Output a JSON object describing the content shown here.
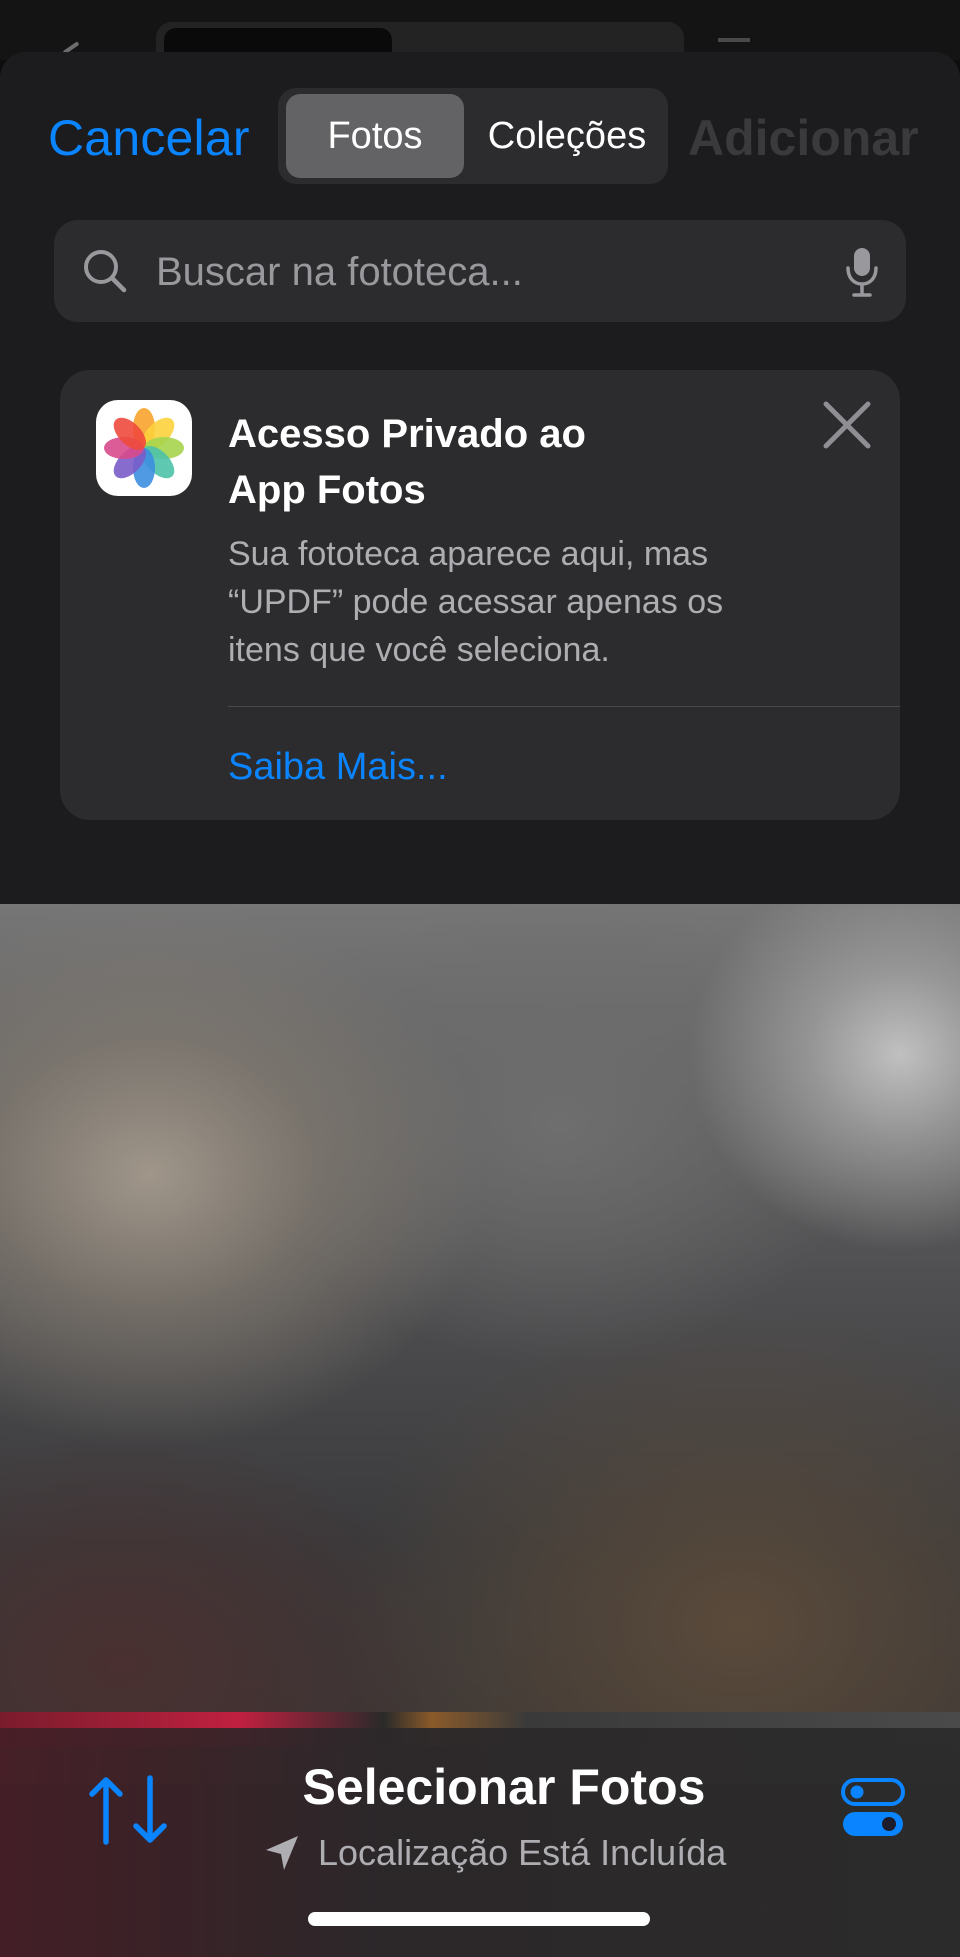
{
  "header": {
    "cancel_label": "Cancelar",
    "segments": [
      "Fotos",
      "Coleções"
    ],
    "active_segment": "Fotos",
    "add_label": "Adicionar"
  },
  "search": {
    "placeholder": "Buscar na fototeca..."
  },
  "notice": {
    "title_line1": "Acesso Privado ao",
    "title_line2": "App Fotos",
    "body_line1": "Sua fototeca aparece aqui, mas",
    "body_line2": "“UPDF” pode acessar apenas os",
    "body_line3": "itens que você seleciona.",
    "link_label": "Saiba Mais..."
  },
  "toolbar": {
    "title": "Selecionar Fotos",
    "subtitle": "Localização Está Incluída"
  },
  "colors": {
    "accent": "#0a84ff",
    "sheet_bg": "#1c1c1e",
    "card_bg": "#2c2c2e",
    "disabled_text": "#3a3a3c"
  },
  "icons": [
    "search-icon",
    "microphone-icon",
    "photos-app-icon",
    "close-icon",
    "sort-arrows-icon",
    "location-arrow-icon",
    "toggles-icon"
  ]
}
